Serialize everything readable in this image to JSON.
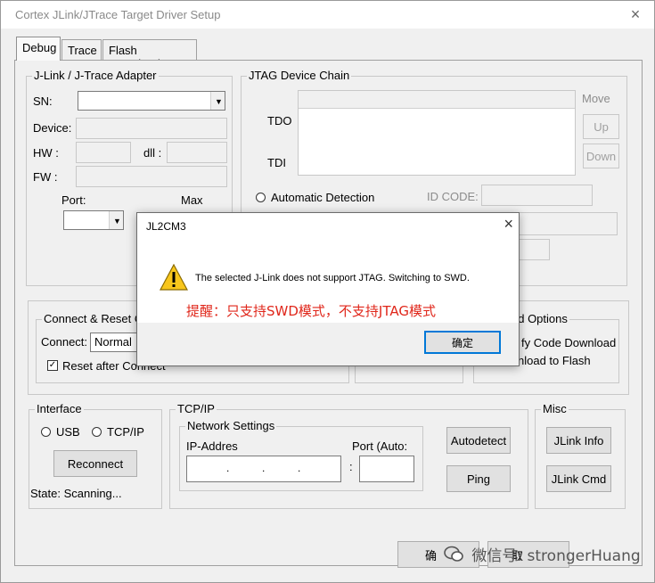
{
  "window": {
    "title": "Cortex JLink/JTrace Target Driver Setup",
    "close": "×"
  },
  "tabs": [
    "Debug",
    "Trace",
    "Flash Download"
  ],
  "adapter": {
    "legend": "J-Link / J-Trace Adapter",
    "sn_label": "SN:",
    "sn_value": "",
    "device_label": "Device:",
    "hw_label": "HW :",
    "dll_label": "dll :",
    "fw_label": "FW :",
    "port_label": "Port:",
    "max_label": "Max",
    "port_value": ""
  },
  "jtag": {
    "legend": "JTAG Device Chain",
    "move_label": "Move",
    "tdo_label": "TDO",
    "tdi_label": "TDI",
    "up_label": "Up",
    "down_label": "Down",
    "auto_detect_label": "Automatic Detection",
    "id_code_label": "ID CODE:"
  },
  "connect": {
    "legend": "Connect & Reset O",
    "connect_label": "Connect:",
    "connect_value": "Normal",
    "reset_after_label": "Reset after Connect"
  },
  "download": {
    "legend": "ad Options",
    "verify_label": "fy Code Download",
    "flash_label": "nload to Flash"
  },
  "interface": {
    "legend": "Interface",
    "usb_label": "USB",
    "tcpip_label": "TCP/IP",
    "reconnect_label": "Reconnect",
    "state_text": "State: Scanning..."
  },
  "tcpip": {
    "legend": "TCP/IP",
    "network_legend": "Network Settings",
    "ip_label": "IP-Addres",
    "ip_dots": ".           .           .",
    "port_label": "Port (Auto:",
    "colon": ":",
    "autodetect_label": "Autodetect",
    "ping_label": "Ping"
  },
  "misc": {
    "legend": "Misc",
    "jlink_info_label": "JLink Info",
    "jlink_cmd_label": "JLink Cmd"
  },
  "bottom_buttons": {
    "ok_label": "确",
    "cancel_label": "取"
  },
  "dialog": {
    "title": "JL2CM3",
    "close": "×",
    "message": "The selected J-Link does not support JTAG. Switching to SWD.",
    "annotation": "提醒：只支持SWD模式，不支持JTAG模式",
    "ok_label": "确定",
    "icon": "warning-icon"
  },
  "watermark": {
    "text": "微信号: strongerHuang",
    "icon": "wechat-icon"
  }
}
